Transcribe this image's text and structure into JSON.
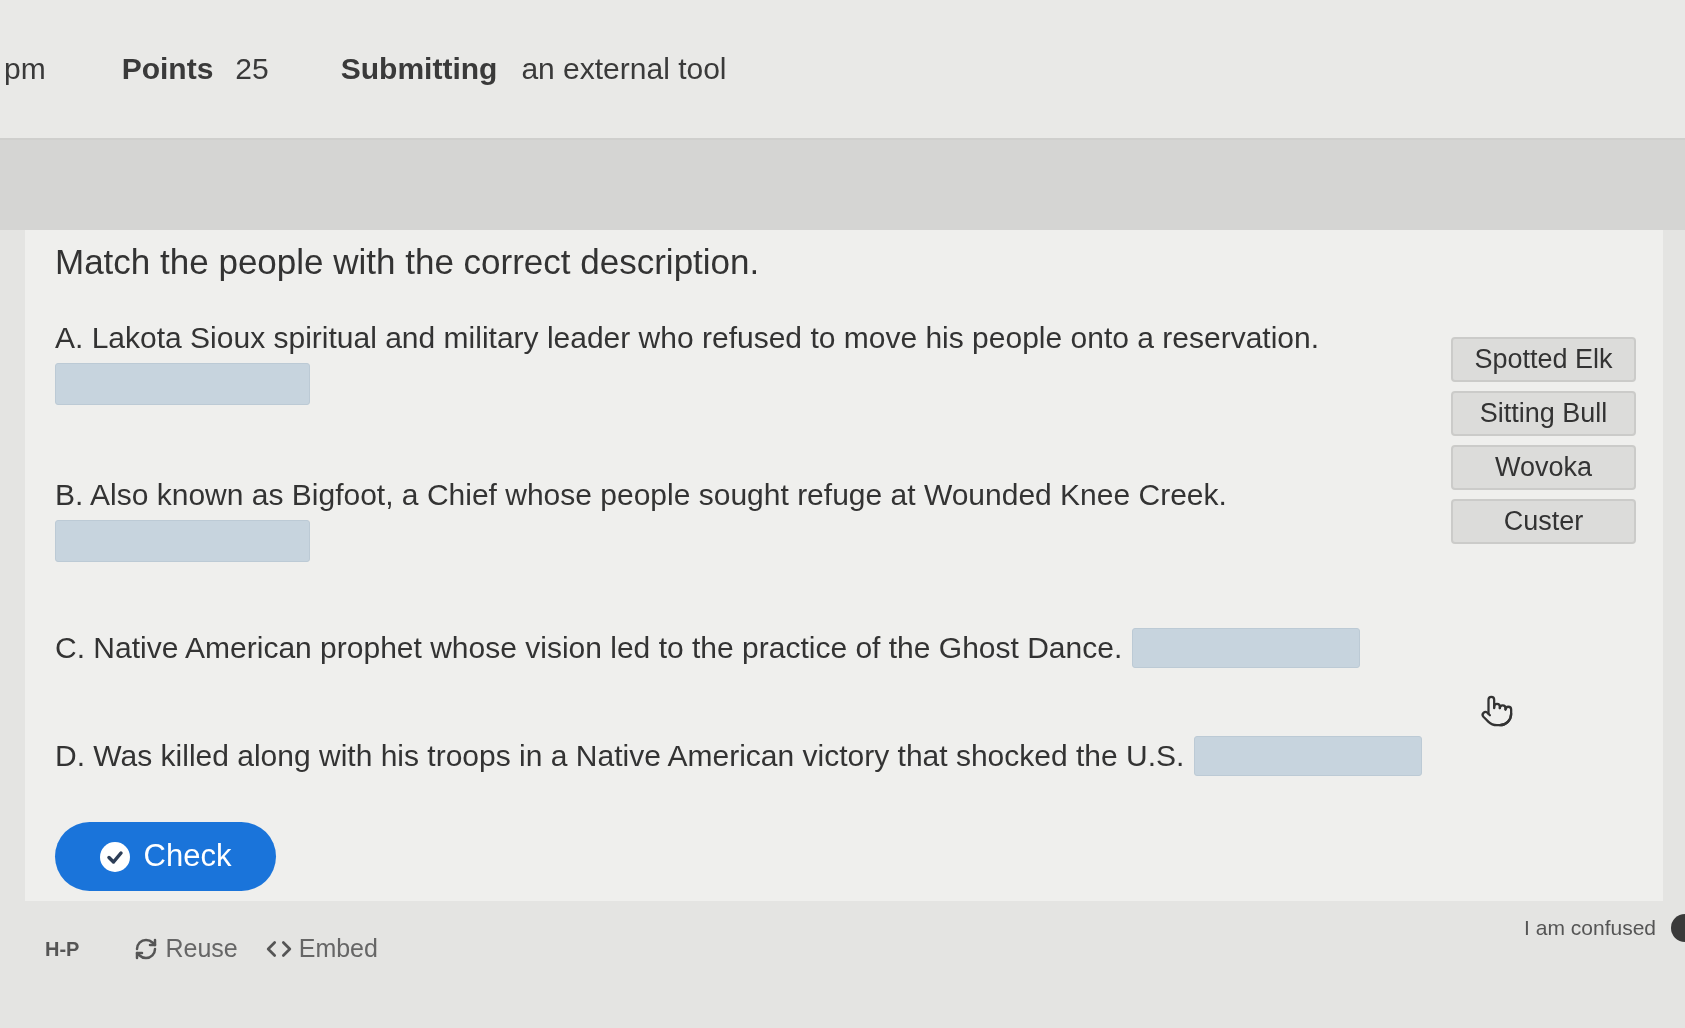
{
  "header": {
    "time": "pm",
    "points_label": "Points",
    "points_value": "25",
    "submitting_label": "Submitting",
    "submitting_value": "an external tool"
  },
  "question": {
    "title": "Match the people with the correct description.",
    "items": [
      {
        "kind": "below",
        "text": "A. Lakota Sioux spiritual and military leader who refused to move his people onto a reservation."
      },
      {
        "kind": "below",
        "text": "B. Also known as Bigfoot, a Chief whose people sought refuge at Wounded Knee Creek."
      },
      {
        "kind": "inline",
        "text": "C. Native American prophet whose vision led to the practice of the Ghost Dance."
      },
      {
        "kind": "inline",
        "text": "D. Was killed along with his troops in a Native American victory that shocked the U.S."
      }
    ],
    "draggables": [
      "Spotted Elk",
      "Sitting Bull",
      "Wovoka",
      "Custer"
    ],
    "check_button": "Check"
  },
  "footer": {
    "logo": "H-P",
    "reuse": "Reuse",
    "embed": "Embed",
    "feedback": "I am confused"
  }
}
